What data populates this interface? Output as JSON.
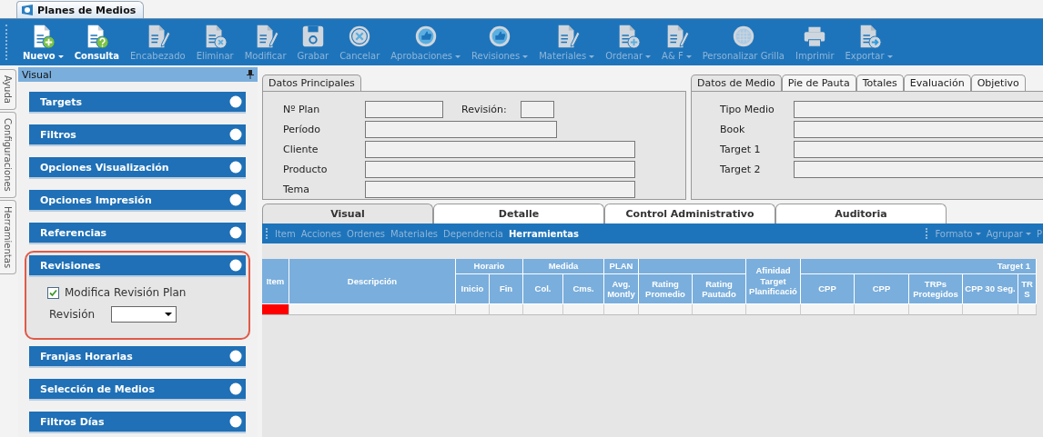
{
  "window": {
    "tab": "Planes de Medios"
  },
  "toolbar": [
    {
      "label": "Nuevo",
      "enabled": true,
      "dropdown": true
    },
    {
      "label": "Consulta",
      "enabled": true,
      "dropdown": false
    },
    {
      "label": "Encabezado",
      "enabled": false,
      "dropdown": false
    },
    {
      "label": "Eliminar",
      "enabled": false,
      "dropdown": false
    },
    {
      "label": "Modificar",
      "enabled": false,
      "dropdown": false
    },
    {
      "label": "Grabar",
      "enabled": false,
      "dropdown": false
    },
    {
      "label": "Cancelar",
      "enabled": false,
      "dropdown": false
    },
    {
      "label": "Aprobaciones",
      "enabled": false,
      "dropdown": true
    },
    {
      "label": "Revisiones",
      "enabled": false,
      "dropdown": true
    },
    {
      "label": "Materiales",
      "enabled": false,
      "dropdown": true
    },
    {
      "label": "Ordenar",
      "enabled": false,
      "dropdown": true
    },
    {
      "label": "A& F",
      "enabled": false,
      "dropdown": true
    },
    {
      "label": "Personalizar Grilla",
      "enabled": false,
      "dropdown": false
    },
    {
      "label": "Imprimir",
      "enabled": false,
      "dropdown": false
    },
    {
      "label": "Exportar",
      "enabled": false,
      "dropdown": true
    }
  ],
  "side_tabs": [
    "Ayuda",
    "Configuraciones",
    "Herramientas"
  ],
  "panel": {
    "title": "Visual",
    "items": [
      {
        "label": "Targets",
        "expanded": false,
        "highlighted": false
      },
      {
        "label": "Filtros",
        "expanded": false,
        "highlighted": false
      },
      {
        "label": "Opciones Visualización",
        "expanded": false,
        "highlighted": false
      },
      {
        "label": "Opciones Impresión",
        "expanded": false,
        "highlighted": false
      },
      {
        "label": "Referencias",
        "expanded": false,
        "highlighted": false
      },
      {
        "label": "Revisiones",
        "expanded": true,
        "highlighted": true,
        "checkbox": {
          "label": "Modifica Revisión Plan",
          "checked": true
        },
        "select": {
          "label": "Revisión"
        }
      },
      {
        "label": "Franjas Horarias",
        "expanded": false,
        "highlighted": false
      },
      {
        "label": "Selección de Medios",
        "expanded": false,
        "highlighted": false
      },
      {
        "label": "Filtros Días",
        "expanded": false,
        "highlighted": false
      }
    ]
  },
  "main_form": {
    "tab": "Datos Principales",
    "rows": [
      [
        {
          "label": "Nº Plan"
        },
        {
          "label": "Revisión:"
        }
      ],
      [
        {
          "label": "Período"
        }
      ],
      [
        {
          "label": "Cliente"
        }
      ],
      [
        {
          "label": "Producto"
        }
      ],
      [
        {
          "label": "Tema"
        }
      ]
    ]
  },
  "media_form": {
    "tabs": [
      {
        "label": "Datos de Medio",
        "selected": true
      },
      {
        "label": "Pie de Pauta",
        "selected": false
      },
      {
        "label": "Totales",
        "selected": false
      },
      {
        "label": "Evaluación",
        "selected": false
      },
      {
        "label": "Objetivo",
        "selected": false
      }
    ],
    "fields": [
      {
        "label": "Tipo Medio"
      },
      {
        "label": "Book"
      },
      {
        "label": "Target 1"
      },
      {
        "label": "Target 2"
      }
    ]
  },
  "view_tabs": [
    {
      "label": "Visual",
      "selected": true
    },
    {
      "label": "Detalle",
      "selected": false
    },
    {
      "label": "Control Administrativo",
      "selected": false
    },
    {
      "label": "Auditoria",
      "selected": false
    }
  ],
  "grid_toolbar": {
    "left": [
      {
        "label": "Item",
        "enabled": false
      },
      {
        "label": "Acciones",
        "enabled": false
      },
      {
        "label": "Ordenes",
        "enabled": false
      },
      {
        "label": "Materiales",
        "enabled": false
      },
      {
        "label": "Dependencia",
        "enabled": false
      },
      {
        "label": "Herramientas",
        "enabled": true
      }
    ],
    "right": [
      {
        "label": "Formato",
        "dropdown": true
      },
      {
        "label": "Agrupar",
        "dropdown": true
      },
      {
        "label": "P",
        "dropdown": false
      }
    ]
  },
  "table": {
    "columns": [
      {
        "label": "Item"
      },
      {
        "label": "Descripción"
      },
      {
        "label": "Horario",
        "children": [
          {
            "label": "Inicio"
          },
          {
            "label": "Fin"
          }
        ]
      },
      {
        "label": "Medida",
        "children": [
          {
            "label": "Col."
          },
          {
            "label": "Cms."
          }
        ]
      },
      {
        "label": "PLAN",
        "children": [
          {
            "label": "Avg. Montly"
          }
        ]
      },
      {
        "children": [
          {
            "label": "Rating Promedio"
          },
          {
            "label": "Rating Pautado"
          }
        ]
      },
      {
        "label": "Afinidad Target Planificació"
      },
      {
        "label": "Target 1",
        "children": [
          {
            "label": "CPP"
          },
          {
            "label": "CPP"
          },
          {
            "label": "TRPs Protegidos"
          },
          {
            "label": "CPP 30 Seg."
          },
          {
            "label": "TR S"
          }
        ]
      }
    ],
    "rows": [
      {
        "marked": true
      }
    ]
  }
}
